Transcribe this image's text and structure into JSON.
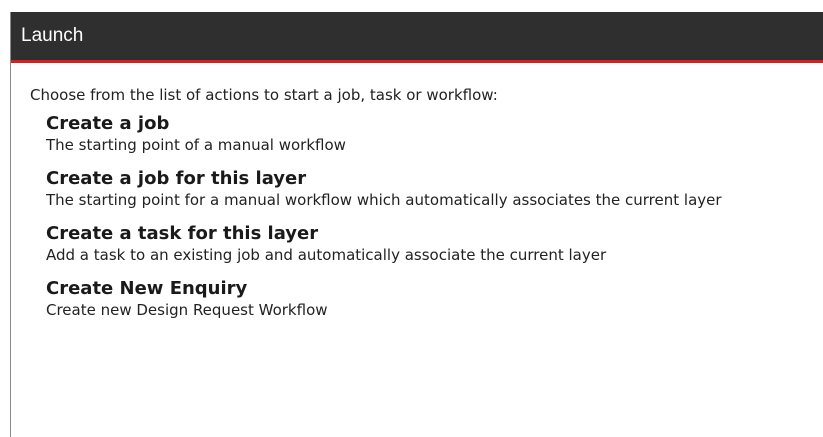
{
  "dialog": {
    "title": "Launch",
    "intro": "Choose from the list of actions to start a job, task or workflow:",
    "actions": [
      {
        "name": "Create a job",
        "description": "The starting point of a manual workflow"
      },
      {
        "name": "Create a job for this layer",
        "description": "The starting point for a manual workflow which automatically associates the current layer"
      },
      {
        "name": "Create a task for this layer",
        "description": "Add a task to an existing job and automatically associate the current layer"
      },
      {
        "name": "Create New Enquiry",
        "description": "Create new Design Request Workflow"
      }
    ]
  },
  "colors": {
    "titlebar_bg": "#2f2f2f",
    "accent_line": "#d42020",
    "text": "#222222"
  }
}
